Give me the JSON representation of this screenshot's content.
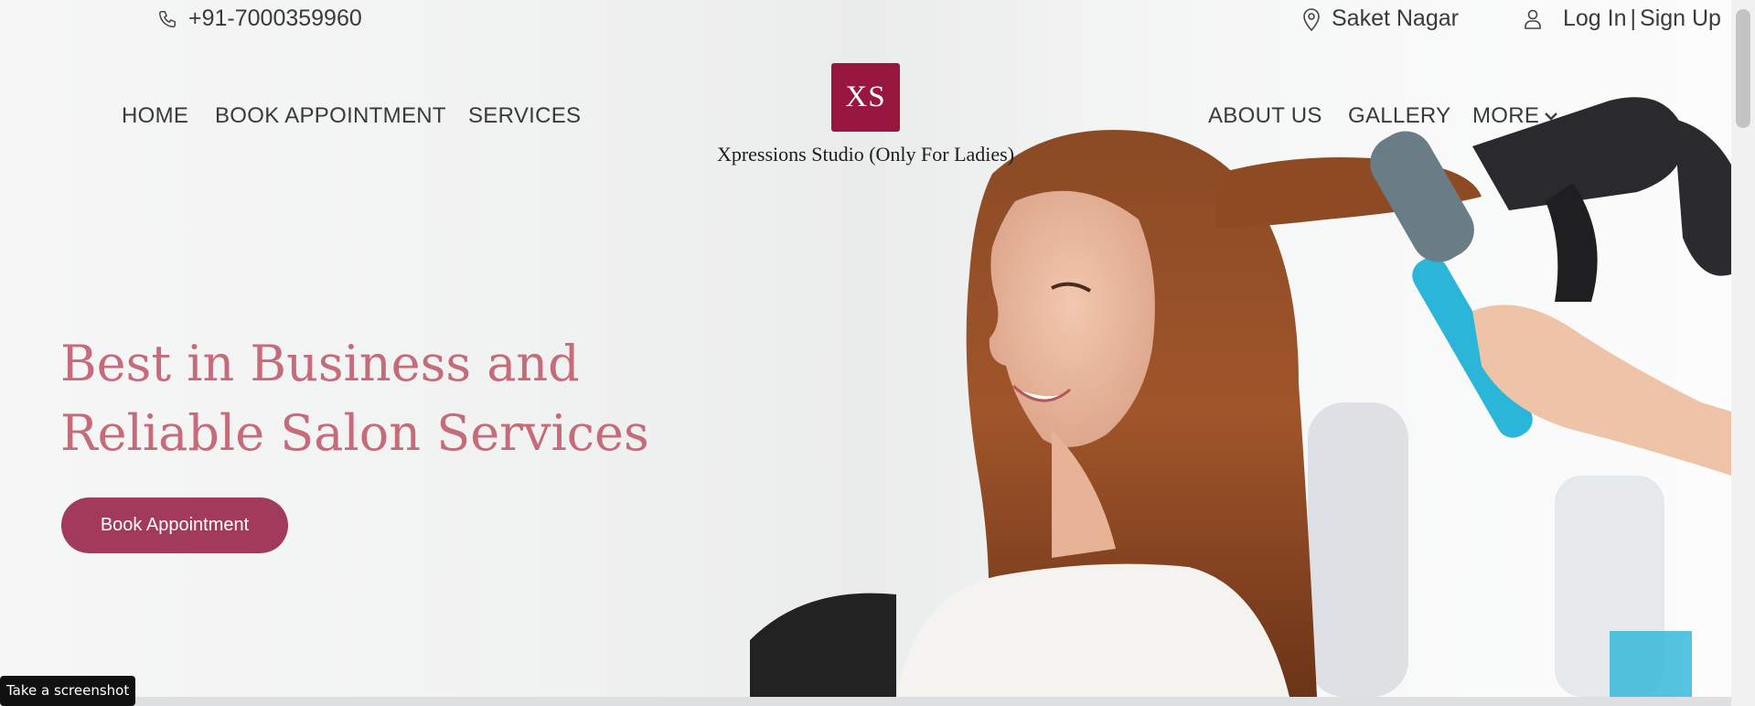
{
  "topbar": {
    "phone": "+91-7000359960",
    "location": "Saket Nagar",
    "login": "Log In",
    "separator": "|",
    "signup": "Sign Up"
  },
  "nav": {
    "home": "HOME",
    "book_appointment": "BOOK APPOINTMENT",
    "services": "SERVICES",
    "about_us": "ABOUT US",
    "gallery": "GALLERY",
    "more": "MORE"
  },
  "brand": {
    "logo_text": "XS",
    "name": "Xpressions Studio (Only For Ladies)",
    "color": "#98173e"
  },
  "hero": {
    "title_line1": "Best in Business and",
    "title_line2": "Reliable Salon Services",
    "title_color": "#c56b79",
    "button_label": "Book Appointment",
    "button_color": "#a13a5b"
  },
  "toast": {
    "label": "Take a screenshot"
  },
  "icons": {
    "phone": "phone-icon",
    "location": "map-pin-icon",
    "user": "user-icon",
    "more": "chevron-down-icon"
  }
}
